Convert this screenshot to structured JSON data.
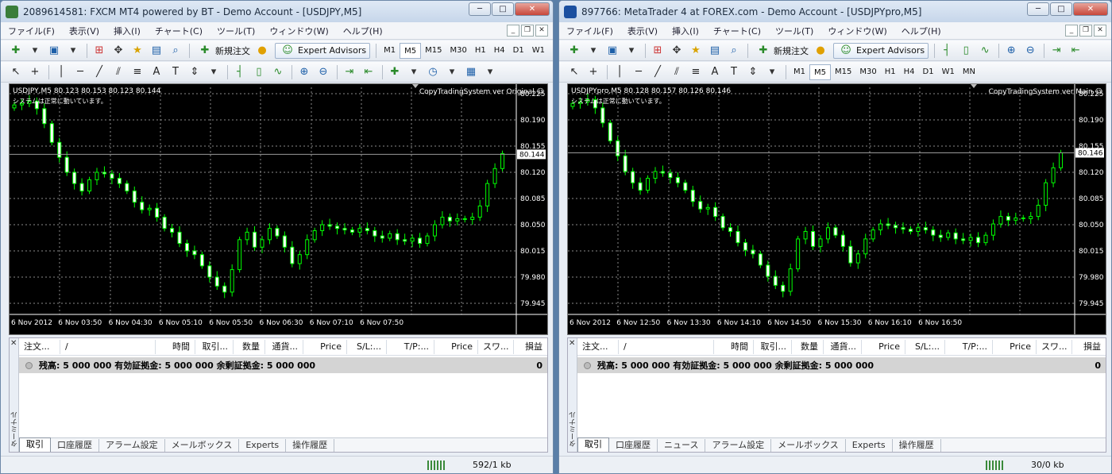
{
  "common": {
    "menu": [
      "ファイル(F)",
      "表示(V)",
      "挿入(I)",
      "チャート(C)",
      "ツール(T)",
      "ウィンドウ(W)",
      "ヘルプ(H)"
    ],
    "new_order": "新規注文",
    "expert_advisors": "Expert Advisors",
    "window_buttons": {
      "minimize": "─",
      "maximize": "□",
      "close": "✕"
    },
    "mdi_buttons": {
      "minimize": "_",
      "restore": "❐",
      "close": "✕"
    },
    "chart_message": "システムは正常に動いています。",
    "terminal_close": "✕",
    "terminal_label": "ターミナル",
    "columns": [
      "注文...",
      "/",
      "時間",
      "取引...",
      "数量",
      "通貨...",
      "Price",
      "S/L:...",
      "T/P:...",
      "Price",
      "スワ...",
      "損益"
    ],
    "balance_text": "残高: 5 000 000  有効証拠金: 5 000 000  余剰証拠金: 5 000 000",
    "balance_value": "0",
    "price_levels": [
      "80.225",
      "80.190",
      "80.155",
      "80.120",
      "80.085",
      "80.050",
      "80.015",
      "79.980",
      "79.945"
    ]
  },
  "windows": [
    {
      "title": "2089614581: FXCM MT4 powered by BT - Demo Account - [USDJPY,M5]",
      "icon_color": "#3a7d3a",
      "timeframes": [
        "M1",
        "M5",
        "M15",
        "M30",
        "H1",
        "H4",
        "D1",
        "W1"
      ],
      "active_timeframe": "M5",
      "symbol_info": "USDJPY,M5  80.123 80.153 80.123 80.144",
      "ea_label": "CopyTradingSystem ver Original ☺",
      "current_price": "80.144",
      "time_labels": [
        "6 Nov 2012",
        "6 Nov 03:50",
        "6 Nov 04:30",
        "6 Nov 05:10",
        "6 Nov 05:50",
        "6 Nov 06:30",
        "6 Nov 07:10",
        "6 Nov 07:50"
      ],
      "tabs": [
        "取引",
        "口座履歴",
        "アラーム設定",
        "メールボックス",
        "Experts",
        "操作履歴"
      ],
      "active_tab": "取引",
      "status_traffic": "592/1 kb"
    },
    {
      "title": "897766: MetaTrader 4 at FOREX.com - Demo Account - [USDJPYpro,M5]",
      "icon_color": "#1a4fa0",
      "timeframes": [
        "M1",
        "M5",
        "M15",
        "M30",
        "H1",
        "H4",
        "D1",
        "W1",
        "MN"
      ],
      "active_timeframe": "M5",
      "symbol_info": "USDJPYpro,M5  80.128 80.157 80.126 80.146",
      "ea_label": "CopyTradingSystem ver Main ☺",
      "current_price": "80.146",
      "time_labels": [
        "6 Nov 2012",
        "6 Nov 12:50",
        "6 Nov 13:30",
        "6 Nov 14:10",
        "6 Nov 14:50",
        "6 Nov 15:30",
        "6 Nov 16:10",
        "6 Nov 16:50"
      ],
      "tabs": [
        "取引",
        "口座履歴",
        "ニュース",
        "アラーム設定",
        "メールボックス",
        "Experts",
        "操作履歴"
      ],
      "active_tab": "取引",
      "status_traffic": "30/0 kb"
    }
  ],
  "chart_data": [
    {
      "type": "candlestick",
      "title": "USDJPY,M5",
      "ylim": [
        79.945,
        80.225
      ],
      "x": [
        "6 Nov 2012",
        "6 Nov 03:50",
        "6 Nov 04:30",
        "6 Nov 05:10",
        "6 Nov 05:50",
        "6 Nov 06:30",
        "6 Nov 07:10",
        "6 Nov 07:50"
      ],
      "closes": [
        80.21,
        80.212,
        80.215,
        80.205,
        80.185,
        80.16,
        80.14,
        80.12,
        80.105,
        80.095,
        80.11,
        80.12,
        80.118,
        80.112,
        80.105,
        80.095,
        80.08,
        80.07,
        80.072,
        80.06,
        80.045,
        80.04,
        80.025,
        80.015,
        80.01,
        79.995,
        79.98,
        79.968,
        79.96,
        79.99,
        80.03,
        80.04,
        80.02,
        80.03,
        80.045,
        80.035,
        80.02,
        79.998,
        80.01,
        80.03,
        80.042,
        80.05,
        80.048,
        80.045,
        80.043,
        80.04,
        80.045,
        80.042,
        80.035,
        80.032,
        80.038,
        80.03,
        80.028,
        80.032,
        80.025,
        80.035,
        80.05,
        80.06,
        80.055,
        80.058,
        80.057,
        80.06,
        80.075,
        80.105,
        80.125,
        80.145
      ],
      "grid": true
    },
    {
      "type": "candlestick",
      "title": "USDJPYpro,M5",
      "ylim": [
        79.945,
        80.225
      ],
      "x": [
        "6 Nov 2012",
        "6 Nov 12:50",
        "6 Nov 13:30",
        "6 Nov 14:10",
        "6 Nov 14:50",
        "6 Nov 15:30",
        "6 Nov 16:10",
        "6 Nov 16:50"
      ],
      "closes": [
        80.212,
        80.214,
        80.217,
        80.206,
        80.186,
        80.162,
        80.142,
        80.121,
        80.106,
        80.096,
        80.112,
        80.121,
        80.119,
        80.113,
        80.106,
        80.096,
        80.081,
        80.071,
        80.073,
        80.061,
        80.046,
        80.041,
        80.026,
        80.016,
        80.011,
        79.996,
        79.981,
        79.969,
        79.961,
        79.991,
        80.031,
        80.041,
        80.021,
        80.031,
        80.046,
        80.036,
        80.021,
        79.999,
        80.011,
        80.031,
        80.043,
        80.051,
        80.049,
        80.046,
        80.044,
        80.041,
        80.046,
        80.043,
        80.036,
        80.033,
        80.039,
        80.031,
        80.029,
        80.033,
        80.026,
        80.036,
        80.051,
        80.061,
        80.056,
        80.059,
        80.058,
        80.061,
        80.076,
        80.106,
        80.126,
        80.146
      ],
      "grid": true
    }
  ]
}
